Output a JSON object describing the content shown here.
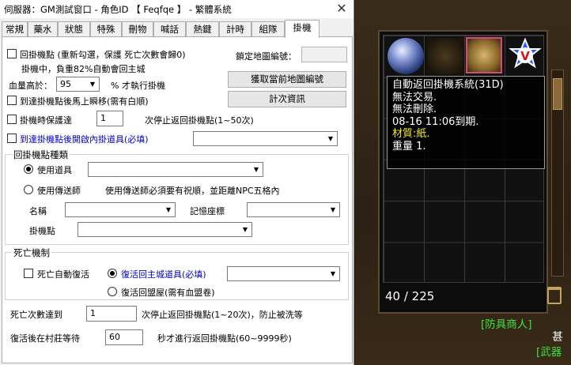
{
  "window": {
    "title": "伺服器：GM測試窗口 - 角色ID 【 Feqfqe 】 - 繁體系統"
  },
  "tabs": [
    "常規",
    "藥水",
    "狀態",
    "特殊",
    "刪物",
    "喊話",
    "熱鍵",
    "計時",
    "組隊",
    "掛機"
  ],
  "active_tab": "掛機",
  "auto": {
    "return_point_label": "回掛機點 (重新勾選，保護 死亡次數會歸0)",
    "status_text": "掛機中，負重82%自動會回主城",
    "lock_map_label": "鎖定地圖編號：",
    "lock_map_value": "",
    "hp_label": "血量高於：",
    "hp_value": "95",
    "hp_suffix": "% 才執行掛機",
    "get_map_button": "獲取當前地圖編號",
    "teleport_label": "到達掛機點後馬上瞬移(需有白順)",
    "timer_button": "計次資訊",
    "protect_label": "掛機時保護達",
    "protect_value": "1",
    "protect_suffix": "次停止返回掛機點(1~50次)",
    "open_item_label": "到達掛機點後開啟內掛道具(必填)",
    "open_item_value": ""
  },
  "return_group": {
    "title": "回掛機點種類",
    "use_item_label": "使用道具",
    "use_item_value": "",
    "use_teleporter_label": "使用傳送師",
    "teleporter_note": "使用傳送師必須要有祝順，並距離NPC五格內",
    "name_label": "名稱",
    "name_value": "",
    "memory_label": "記憶座標",
    "memory_value": "",
    "point_label": "掛機點",
    "point_value": ""
  },
  "death_group": {
    "title": "死亡機制",
    "auto_revive_label": "死亡自動復活",
    "revive_item_label": "復活回主城道具(必填)",
    "revive_item_value": "",
    "revive_clan_label": "復活回盟屋(需有血盟卷)",
    "death_count_label": "死亡次數達到",
    "death_count_value": "1",
    "death_count_suffix": "次停止返回掛機點(1~20次)，防止被洗等",
    "wait_label": "復活後在村莊等待",
    "wait_value": "60",
    "wait_suffix": "秒才進行返回掛機點(60~9999秒)"
  },
  "game": {
    "tooltip": {
      "name": "自動返回掛機系統(31D)",
      "line1": "無法交易.",
      "line2": "無法刪除.",
      "line3": "08-16 11:06到期.",
      "material": "材質:紙.",
      "weight": "重量 1."
    },
    "inventory_count": "40 / 225",
    "npc_label": "[防具商人]",
    "npc_name_partial": "甚",
    "npc_label2": "[武器"
  },
  "icons": {
    "close": "close-icon",
    "dropdown": "chevron-down-icon",
    "orb": "crystal-orb-icon",
    "scroll": "return-scroll-icon",
    "vstar": "v-star-icon",
    "trash": "trash-icon"
  }
}
